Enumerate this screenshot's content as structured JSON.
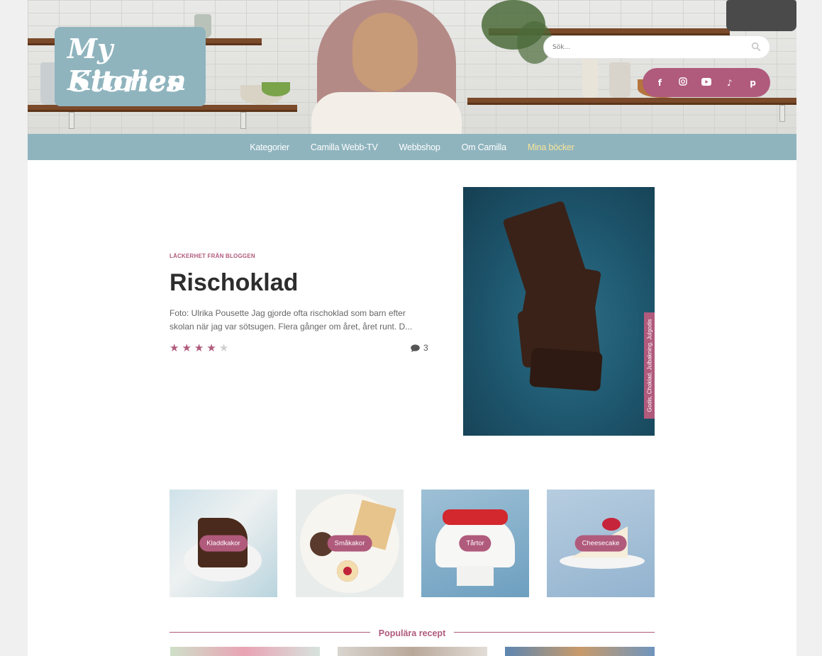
{
  "header": {
    "logo_line1": "My Kitchen",
    "logo_line2": "Stories",
    "search_placeholder": "Sök...",
    "social_icons": [
      "facebook-icon",
      "instagram-icon",
      "youtube-icon",
      "tiktok-icon",
      "pinterest-icon"
    ]
  },
  "nav": {
    "items": [
      {
        "label": "Kategorier"
      },
      {
        "label": "Camilla Webb-TV"
      },
      {
        "label": "Webbshop"
      },
      {
        "label": "Om Camilla"
      },
      {
        "label": "Mina böcker"
      }
    ]
  },
  "hero": {
    "eyebrow": "LÄCKERHET FRÅN BLOGGEN",
    "title": "Rischoklad",
    "excerpt": "Foto: Ulrika Pousette Jag gjorde ofta rischoklad som barn efter skolan när jag var sötsugen. Flera gånger om året, året runt. D...",
    "rating": 4,
    "rating_max": 5,
    "comment_count": "3",
    "tags": "Godis, Choklad, Julbakning, Julgodis"
  },
  "categories": [
    {
      "label": "Kladdkakor"
    },
    {
      "label": "Småkakor"
    },
    {
      "label": "Tårtor"
    },
    {
      "label": "Cheesecake"
    }
  ],
  "popular": {
    "title": "Populära recept"
  },
  "colors": {
    "accent": "#b05a7c",
    "nav_bg": "#8fb4be",
    "nav_highlight": "#f8e59a",
    "star_filled": "#b05a7c",
    "star_empty": "#cfcfcf"
  }
}
